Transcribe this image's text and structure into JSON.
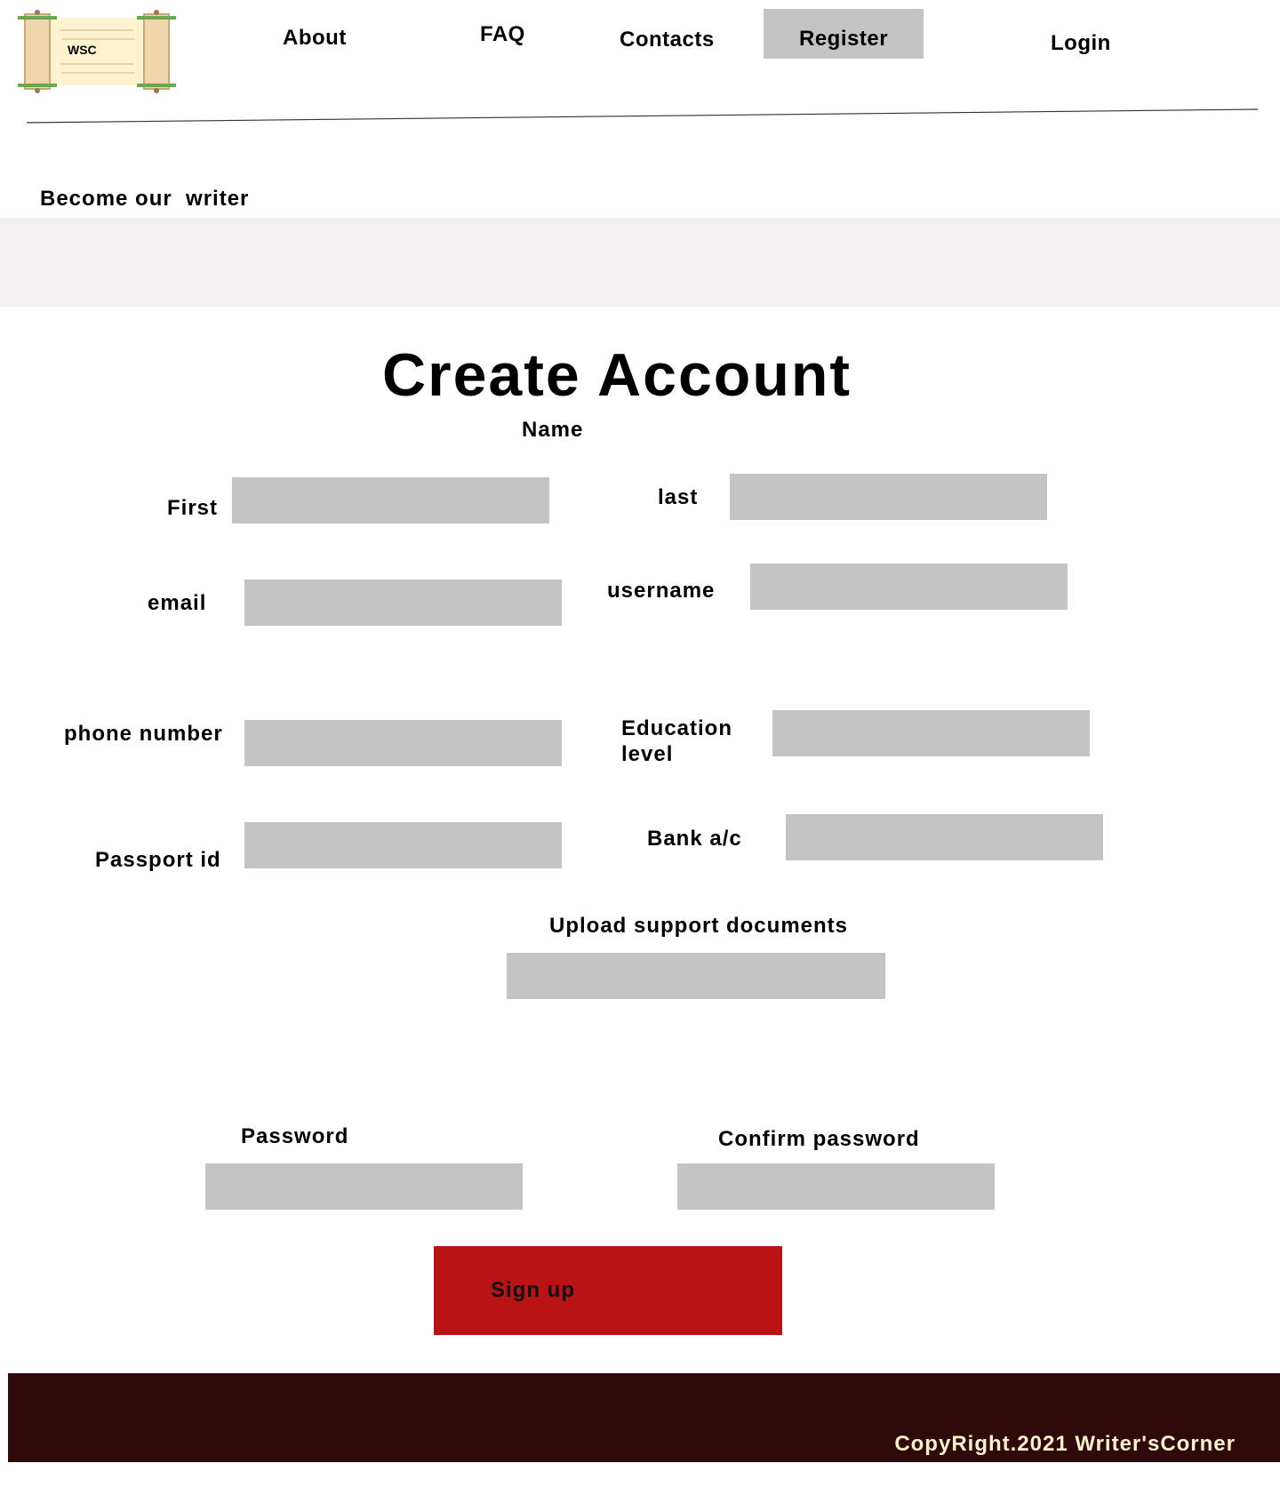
{
  "logo": {
    "text": "WSC"
  },
  "nav": {
    "about": "About",
    "faq": "FAQ",
    "contacts": "Contacts",
    "register": "Register",
    "login": "Login"
  },
  "banner": {
    "text": "Become our  writer"
  },
  "form": {
    "title": "Create Account",
    "name_label": "Name",
    "first_label": "First",
    "last_label": "last",
    "email_label": "email",
    "username_label": "username",
    "phone_label": "phone number",
    "education_label_line1": "Education",
    "education_label_line2": "level",
    "passport_label": "Passport id",
    "bank_label": "Bank a/c",
    "upload_label": "Upload support documents",
    "password_label": "Password",
    "confirm_password_label": "Confirm password",
    "signup_label": "Sign up"
  },
  "footer": {
    "copyright": "CopyRight.2021 Writer'sCorner"
  },
  "colors": {
    "field": "#c4c4c4",
    "accent": "#b91316",
    "footer": "#300a0b",
    "band": "#f2f0f1",
    "footer_text": "#fff1cc"
  }
}
